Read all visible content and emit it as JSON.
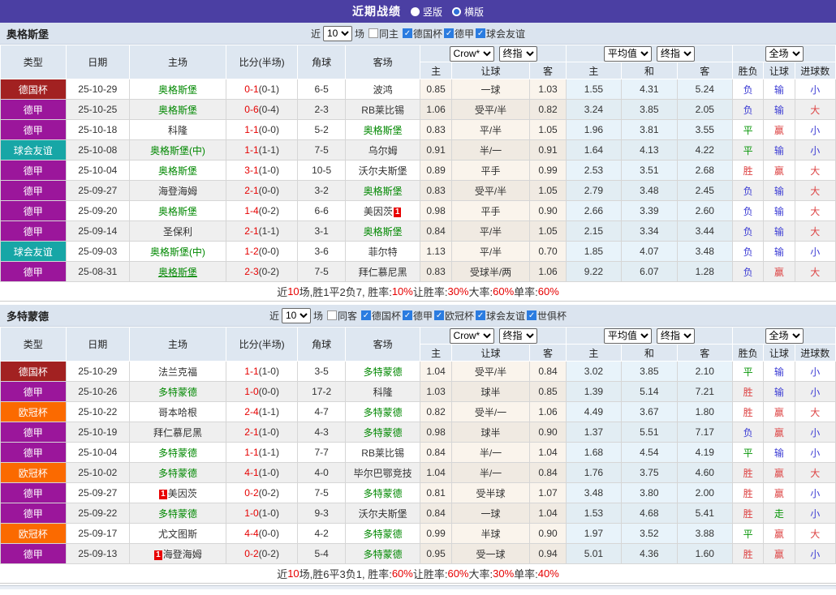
{
  "title_bar": {
    "title": "近期战绩",
    "options": [
      {
        "label": "竖版",
        "selected": false
      },
      {
        "label": "横版",
        "selected": true
      }
    ]
  },
  "columns": {
    "type": "类型",
    "date": "日期",
    "home": "主场",
    "score": "比分(半场)",
    "corner": "角球",
    "away": "客场",
    "sub_home": "主",
    "sub_handicap": "让球",
    "sub_draw": "和",
    "sub_away": "客",
    "outcome_wl": "胜负",
    "outcome_handicap": "让球",
    "outcome_goals": "进球数"
  },
  "selects": {
    "odds_company": "Crow*",
    "odds_stage": "终指",
    "avg_company": "平均值",
    "avg_stage": "终指",
    "scope": "全场"
  },
  "filter_labels": {
    "near": "近",
    "games": "场"
  },
  "league_colors": {
    "德国杯": "#A22121",
    "德甲": "#9B169B",
    "欧冠杯": "#FB6A00",
    "球会友谊": "#17A6A6",
    "世俱杯": "#17A6A6"
  },
  "sections": [
    {
      "team": "奥格斯堡",
      "filter": {
        "count": "10",
        "same_label": "同主",
        "same_checked": false,
        "leagues": [
          {
            "label": "德国杯",
            "checked": true
          },
          {
            "label": "德甲",
            "checked": true
          },
          {
            "label": "球会友谊",
            "checked": true
          }
        ]
      },
      "rows": [
        {
          "league": "德国杯",
          "date": "25-10-29",
          "home": {
            "name": "奥格斯堡",
            "focus": true
          },
          "score": "0-1",
          "half": "(0-1)",
          "corner": "6-5",
          "away": {
            "name": "波鸿"
          },
          "odds": [
            "0.85",
            "一球",
            "1.03"
          ],
          "avg": [
            "1.55",
            "4.31",
            "5.24"
          ],
          "result": [
            [
              "负",
              "b"
            ],
            [
              "输",
              "b"
            ],
            [
              "小",
              "b"
            ]
          ]
        },
        {
          "league": "德甲",
          "date": "25-10-25",
          "home": {
            "name": "奥格斯堡",
            "focus": true
          },
          "score": "0-6",
          "half": "(0-4)",
          "corner": "2-3",
          "away": {
            "name": "RB莱比锡"
          },
          "odds": [
            "1.06",
            "受平/半",
            "0.82"
          ],
          "avg": [
            "3.24",
            "3.85",
            "2.05"
          ],
          "result": [
            [
              "负",
              "b"
            ],
            [
              "输",
              "b"
            ],
            [
              "大",
              "r"
            ]
          ]
        },
        {
          "league": "德甲",
          "date": "25-10-18",
          "home": {
            "name": "科隆"
          },
          "score": "1-1",
          "half": "(0-0)",
          "corner": "5-2",
          "away": {
            "name": "奥格斯堡",
            "focus": true
          },
          "odds": [
            "0.83",
            "平/半",
            "1.05"
          ],
          "avg": [
            "1.96",
            "3.81",
            "3.55"
          ],
          "result": [
            [
              "平",
              "g"
            ],
            [
              "赢",
              "r"
            ],
            [
              "小",
              "b"
            ]
          ]
        },
        {
          "league": "球会友谊",
          "date": "25-10-08",
          "home": {
            "name": "奥格斯堡(中)",
            "focus": true
          },
          "score": "1-1",
          "half": "(1-1)",
          "corner": "7-5",
          "away": {
            "name": "乌尔姆"
          },
          "odds": [
            "0.91",
            "半/一",
            "0.91"
          ],
          "avg": [
            "1.64",
            "4.13",
            "4.22"
          ],
          "result": [
            [
              "平",
              "g"
            ],
            [
              "输",
              "b"
            ],
            [
              "小",
              "b"
            ]
          ]
        },
        {
          "league": "德甲",
          "date": "25-10-04",
          "home": {
            "name": "奥格斯堡",
            "focus": true
          },
          "score": "3-1",
          "half": "(1-0)",
          "corner": "10-5",
          "away": {
            "name": "沃尔夫斯堡"
          },
          "odds": [
            "0.89",
            "平手",
            "0.99"
          ],
          "avg": [
            "2.53",
            "3.51",
            "2.68"
          ],
          "result": [
            [
              "胜",
              "r"
            ],
            [
              "赢",
              "r"
            ],
            [
              "大",
              "r"
            ]
          ]
        },
        {
          "league": "德甲",
          "date": "25-09-27",
          "home": {
            "name": "海登海姆"
          },
          "score": "2-1",
          "half": "(0-0)",
          "corner": "3-2",
          "away": {
            "name": "奥格斯堡",
            "focus": true
          },
          "odds": [
            "0.83",
            "受平/半",
            "1.05"
          ],
          "avg": [
            "2.79",
            "3.48",
            "2.45"
          ],
          "result": [
            [
              "负",
              "b"
            ],
            [
              "输",
              "b"
            ],
            [
              "大",
              "r"
            ]
          ]
        },
        {
          "league": "德甲",
          "date": "25-09-20",
          "home": {
            "name": "奥格斯堡",
            "focus": true
          },
          "score": "1-4",
          "half": "(0-2)",
          "corner": "6-6",
          "away": {
            "name": "美因茨",
            "badge": "1",
            "badge_pos": "after"
          },
          "odds": [
            "0.98",
            "平手",
            "0.90"
          ],
          "avg": [
            "2.66",
            "3.39",
            "2.60"
          ],
          "result": [
            [
              "负",
              "b"
            ],
            [
              "输",
              "b"
            ],
            [
              "大",
              "r"
            ]
          ]
        },
        {
          "league": "德甲",
          "date": "25-09-14",
          "home": {
            "name": "圣保利"
          },
          "score": "2-1",
          "half": "(1-1)",
          "corner": "3-1",
          "away": {
            "name": "奥格斯堡",
            "focus": true
          },
          "odds": [
            "0.84",
            "平/半",
            "1.05"
          ],
          "avg": [
            "2.15",
            "3.34",
            "3.44"
          ],
          "result": [
            [
              "负",
              "b"
            ],
            [
              "输",
              "b"
            ],
            [
              "大",
              "r"
            ]
          ]
        },
        {
          "league": "球会友谊",
          "date": "25-09-03",
          "home": {
            "name": "奥格斯堡(中)",
            "focus": true
          },
          "score": "1-2",
          "half": "(0-0)",
          "corner": "3-6",
          "away": {
            "name": "菲尔特"
          },
          "odds": [
            "1.13",
            "平/半",
            "0.70"
          ],
          "avg": [
            "1.85",
            "4.07",
            "3.48"
          ],
          "result": [
            [
              "负",
              "b"
            ],
            [
              "输",
              "b"
            ],
            [
              "小",
              "b"
            ]
          ]
        },
        {
          "league": "德甲",
          "date": "25-08-31",
          "home": {
            "name": "奥格斯堡",
            "focus": true,
            "underline": true
          },
          "score": "2-3",
          "half": "(0-2)",
          "corner": "7-5",
          "away": {
            "name": "拜仁慕尼黑"
          },
          "odds": [
            "0.83",
            "受球半/两",
            "1.06"
          ],
          "avg": [
            "9.22",
            "6.07",
            "1.28"
          ],
          "result": [
            [
              "负",
              "b"
            ],
            [
              "赢",
              "r"
            ],
            [
              "大",
              "r"
            ]
          ]
        }
      ],
      "summary": [
        [
          "近",
          false
        ],
        [
          "10",
          true
        ],
        [
          "场,胜1平2负7, 胜率:",
          false
        ],
        [
          "10%",
          true
        ],
        [
          " 让胜率:",
          false
        ],
        [
          "30%",
          true
        ],
        [
          " 大率:",
          false
        ],
        [
          "60%",
          true
        ],
        [
          " 单率:",
          false
        ],
        [
          "60%",
          true
        ]
      ]
    },
    {
      "team": "多特蒙德",
      "filter": {
        "count": "10",
        "same_label": "同客",
        "same_checked": false,
        "leagues": [
          {
            "label": "德国杯",
            "checked": true
          },
          {
            "label": "德甲",
            "checked": true
          },
          {
            "label": "欧冠杯",
            "checked": true
          },
          {
            "label": "球会友谊",
            "checked": true
          },
          {
            "label": "世俱杯",
            "checked": true
          }
        ]
      },
      "rows": [
        {
          "league": "德国杯",
          "date": "25-10-29",
          "home": {
            "name": "法兰克福"
          },
          "score": "1-1",
          "half": "(1-0)",
          "corner": "3-5",
          "away": {
            "name": "多特蒙德",
            "focus": true
          },
          "odds": [
            "1.04",
            "受平/半",
            "0.84"
          ],
          "avg": [
            "3.02",
            "3.85",
            "2.10"
          ],
          "result": [
            [
              "平",
              "g"
            ],
            [
              "输",
              "b"
            ],
            [
              "小",
              "b"
            ]
          ]
        },
        {
          "league": "德甲",
          "date": "25-10-26",
          "home": {
            "name": "多特蒙德",
            "focus": true
          },
          "score": "1-0",
          "half": "(0-0)",
          "corner": "17-2",
          "away": {
            "name": "科隆"
          },
          "odds": [
            "1.03",
            "球半",
            "0.85"
          ],
          "avg": [
            "1.39",
            "5.14",
            "7.21"
          ],
          "result": [
            [
              "胜",
              "r"
            ],
            [
              "输",
              "b"
            ],
            [
              "小",
              "b"
            ]
          ]
        },
        {
          "league": "欧冠杯",
          "date": "25-10-22",
          "home": {
            "name": "哥本哈根"
          },
          "score": "2-4",
          "half": "(1-1)",
          "corner": "4-7",
          "away": {
            "name": "多特蒙德",
            "focus": true
          },
          "odds": [
            "0.82",
            "受半/一",
            "1.06"
          ],
          "avg": [
            "4.49",
            "3.67",
            "1.80"
          ],
          "result": [
            [
              "胜",
              "r"
            ],
            [
              "赢",
              "r"
            ],
            [
              "大",
              "r"
            ]
          ]
        },
        {
          "league": "德甲",
          "date": "25-10-19",
          "home": {
            "name": "拜仁慕尼黑"
          },
          "score": "2-1",
          "half": "(1-0)",
          "corner": "4-3",
          "away": {
            "name": "多特蒙德",
            "focus": true
          },
          "odds": [
            "0.98",
            "球半",
            "0.90"
          ],
          "avg": [
            "1.37",
            "5.51",
            "7.17"
          ],
          "result": [
            [
              "负",
              "b"
            ],
            [
              "赢",
              "r"
            ],
            [
              "小",
              "b"
            ]
          ]
        },
        {
          "league": "德甲",
          "date": "25-10-04",
          "home": {
            "name": "多特蒙德",
            "focus": true
          },
          "score": "1-1",
          "half": "(1-1)",
          "corner": "7-7",
          "away": {
            "name": "RB莱比锡"
          },
          "odds": [
            "0.84",
            "半/一",
            "1.04"
          ],
          "avg": [
            "1.68",
            "4.54",
            "4.19"
          ],
          "result": [
            [
              "平",
              "g"
            ],
            [
              "输",
              "b"
            ],
            [
              "小",
              "b"
            ]
          ]
        },
        {
          "league": "欧冠杯",
          "date": "25-10-02",
          "home": {
            "name": "多特蒙德",
            "focus": true
          },
          "score": "4-1",
          "half": "(1-0)",
          "corner": "4-0",
          "away": {
            "name": "毕尔巴鄂竞技"
          },
          "odds": [
            "1.04",
            "半/一",
            "0.84"
          ],
          "avg": [
            "1.76",
            "3.75",
            "4.60"
          ],
          "result": [
            [
              "胜",
              "r"
            ],
            [
              "赢",
              "r"
            ],
            [
              "大",
              "r"
            ]
          ]
        },
        {
          "league": "德甲",
          "date": "25-09-27",
          "home": {
            "name": "美因茨",
            "badge": "1",
            "badge_pos": "before"
          },
          "score": "0-2",
          "half": "(0-2)",
          "corner": "7-5",
          "away": {
            "name": "多特蒙德",
            "focus": true
          },
          "odds": [
            "0.81",
            "受半球",
            "1.07"
          ],
          "avg": [
            "3.48",
            "3.80",
            "2.00"
          ],
          "result": [
            [
              "胜",
              "r"
            ],
            [
              "赢",
              "r"
            ],
            [
              "小",
              "b"
            ]
          ]
        },
        {
          "league": "德甲",
          "date": "25-09-22",
          "home": {
            "name": "多特蒙德",
            "focus": true
          },
          "score": "1-0",
          "half": "(1-0)",
          "corner": "9-3",
          "away": {
            "name": "沃尔夫斯堡"
          },
          "odds": [
            "0.84",
            "一球",
            "1.04"
          ],
          "avg": [
            "1.53",
            "4.68",
            "5.41"
          ],
          "result": [
            [
              "胜",
              "r"
            ],
            [
              "走",
              "g"
            ],
            [
              "小",
              "b"
            ]
          ]
        },
        {
          "league": "欧冠杯",
          "date": "25-09-17",
          "home": {
            "name": "尤文图斯"
          },
          "score": "4-4",
          "half": "(0-0)",
          "corner": "4-2",
          "away": {
            "name": "多特蒙德",
            "focus": true
          },
          "odds": [
            "0.99",
            "半球",
            "0.90"
          ],
          "avg": [
            "1.97",
            "3.52",
            "3.88"
          ],
          "result": [
            [
              "平",
              "g"
            ],
            [
              "赢",
              "r"
            ],
            [
              "大",
              "r"
            ]
          ]
        },
        {
          "league": "德甲",
          "date": "25-09-13",
          "home": {
            "name": "海登海姆",
            "badge": "1",
            "badge_pos": "before"
          },
          "score": "0-2",
          "half": "(0-2)",
          "corner": "5-4",
          "away": {
            "name": "多特蒙德",
            "focus": true
          },
          "odds": [
            "0.95",
            "受一球",
            "0.94"
          ],
          "avg": [
            "5.01",
            "4.36",
            "1.60"
          ],
          "result": [
            [
              "胜",
              "r"
            ],
            [
              "赢",
              "r"
            ],
            [
              "小",
              "b"
            ]
          ]
        }
      ],
      "summary": [
        [
          "近",
          false
        ],
        [
          "10",
          true
        ],
        [
          "场,胜6平3负1, 胜率:",
          false
        ],
        [
          "60%",
          true
        ],
        [
          " 让胜率:",
          false
        ],
        [
          "60%",
          true
        ],
        [
          " 大率:",
          false
        ],
        [
          "30%",
          true
        ],
        [
          " 单率:",
          false
        ],
        [
          "40%",
          true
        ]
      ]
    }
  ]
}
